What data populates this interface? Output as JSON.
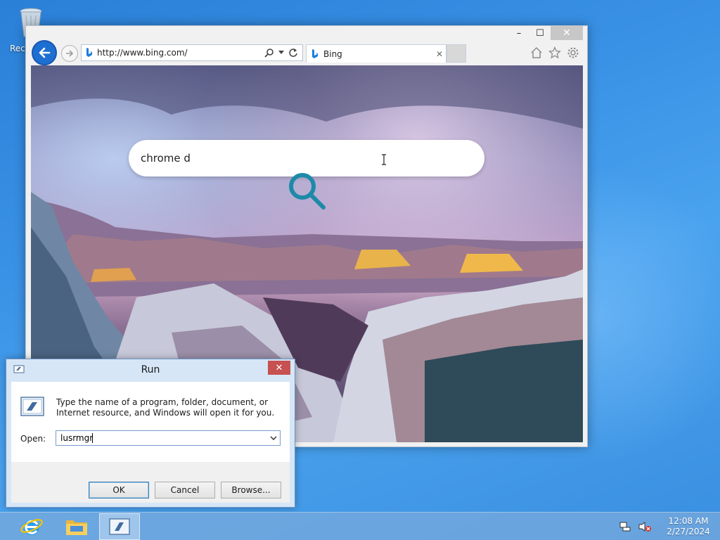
{
  "desktop": {
    "recycle_bin_label": "Recyc"
  },
  "browser": {
    "window_controls": {
      "minimize": "–",
      "maximize": "☐",
      "close": "✕"
    },
    "address_url": "http://www.bing.com/",
    "tab_title": "Bing",
    "tab_close": "✕",
    "search_query": "chrome d",
    "colors": {
      "accent": "#1e6fd2",
      "search_glass": "#1d8aa8"
    }
  },
  "run_dialog": {
    "title": "Run",
    "close": "✕",
    "description": "Type the name of a program, folder, document, or Internet resource, and Windows will open it for you.",
    "open_label": "Open:",
    "open_value": "lusrmgr",
    "ok_label": "OK",
    "cancel_label": "Cancel",
    "browse_label": "Browse..."
  },
  "taskbar": {
    "items": [
      "internet-explorer-icon",
      "file-explorer-icon",
      "run-icon"
    ],
    "clock_time": "12:08 AM",
    "clock_date": "2/27/2024"
  }
}
